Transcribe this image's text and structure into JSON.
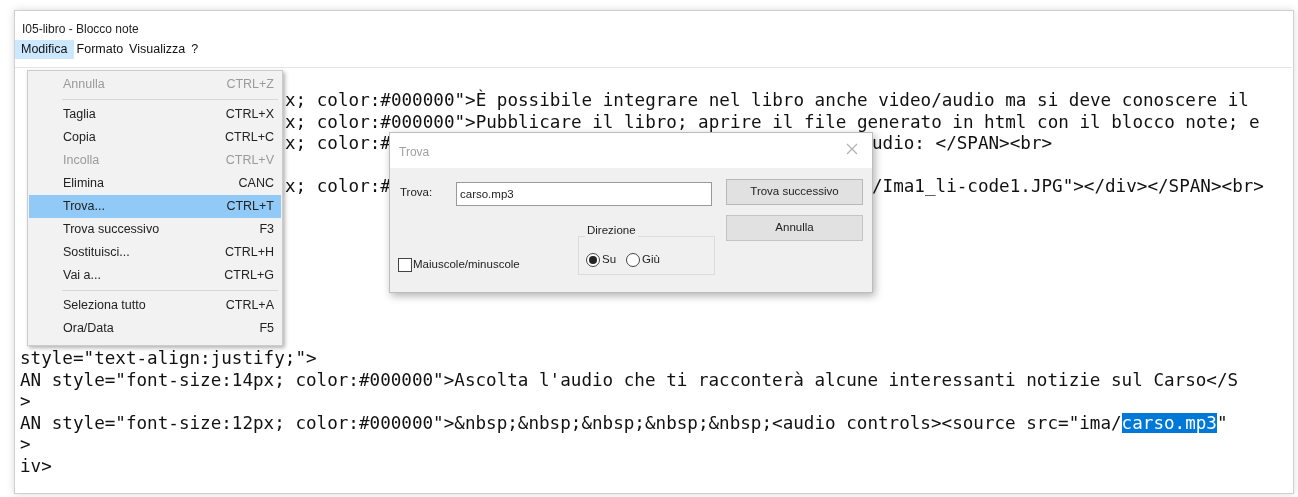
{
  "window": {
    "title": "I05-libro - Blocco note"
  },
  "menubar": [
    {
      "label": "Modifica",
      "selected": true
    },
    {
      "label": "Formato",
      "selected": false
    },
    {
      "label": "Visualizza",
      "selected": false
    },
    {
      "label": "?",
      "selected": false
    }
  ],
  "editor": {
    "lines": [
      {
        "kind": "partial",
        "text": "x; color:#000000\">È possibile integrare nel libro anche video/audio ma si deve conoscere il"
      },
      {
        "kind": "partial",
        "text": "x; color:#000000\">Pubblicare il libro; aprire il file generato in html con il blocco note; e"
      },
      {
        "kind": "split",
        "left": "x; color:#",
        "right": "udio: </SPAN><br>"
      },
      {
        "kind": "blank"
      },
      {
        "kind": "split",
        "left": "x; color:#",
        "right": "/Ima1_li-code1.JPG\"></div></SPAN><br>"
      },
      {
        "kind": "blank"
      },
      {
        "kind": "blank"
      },
      {
        "kind": "blank"
      },
      {
        "kind": "blank"
      },
      {
        "kind": "blank"
      },
      {
        "kind": "blank"
      },
      {
        "kind": "blank"
      },
      {
        "kind": "full",
        "text": "style=\"text-align:justify;\">"
      },
      {
        "kind": "full",
        "text": "AN style=\"font-size:14px; color:#000000\">Ascolta l'audio che ti racconterà alcune interessanti notizie sul Carso</S"
      },
      {
        "kind": "full",
        "text": ">"
      },
      {
        "kind": "selection",
        "before": "AN style=\"font-size:12px; color:#000000\">&nbsp;&nbsp;&nbsp;&nbsp;&nbsp;<audio controls><source src=\"ima/",
        "selected": "carso.mp3",
        "after": "\""
      },
      {
        "kind": "full",
        "text": ">"
      },
      {
        "kind": "full",
        "text": "iv>"
      }
    ]
  },
  "edit_menu": {
    "items": [
      {
        "label": "Annulla",
        "shortcut": "CTRL+Z",
        "disabled": true,
        "highlighted": false,
        "separator_after": true
      },
      {
        "label": "Taglia",
        "shortcut": "CTRL+X",
        "disabled": false,
        "highlighted": false,
        "separator_after": false
      },
      {
        "label": "Copia",
        "shortcut": "CTRL+C",
        "disabled": false,
        "highlighted": false,
        "separator_after": false
      },
      {
        "label": "Incolla",
        "shortcut": "CTRL+V",
        "disabled": true,
        "highlighted": false,
        "separator_after": false
      },
      {
        "label": "Elimina",
        "shortcut": "CANC",
        "disabled": false,
        "highlighted": false,
        "separator_after": false
      },
      {
        "label": "Trova...",
        "shortcut": "CTRL+T",
        "disabled": false,
        "highlighted": true,
        "separator_after": false
      },
      {
        "label": "Trova successivo",
        "shortcut": "F3",
        "disabled": false,
        "highlighted": false,
        "separator_after": false
      },
      {
        "label": "Sostituisci...",
        "shortcut": "CTRL+H",
        "disabled": false,
        "highlighted": false,
        "separator_after": false
      },
      {
        "label": "Vai a...",
        "shortcut": "CTRL+G",
        "disabled": false,
        "highlighted": false,
        "separator_after": true
      },
      {
        "label": "Seleziona tutto",
        "shortcut": "CTRL+A",
        "disabled": false,
        "highlighted": false,
        "separator_after": false
      },
      {
        "label": "Ora/Data",
        "shortcut": "F5",
        "disabled": false,
        "highlighted": false,
        "separator_after": false
      }
    ]
  },
  "find_dialog": {
    "title": "Trova",
    "find_label": "Trova:",
    "find_value": "carso.mp3",
    "buttons": [
      {
        "label": "Trova successivo",
        "default": true
      },
      {
        "label": "Annulla",
        "default": false
      }
    ],
    "direction": {
      "legend": "Direzione",
      "options": [
        {
          "label": "Su",
          "selected": true
        },
        {
          "label": "Giù",
          "selected": false
        }
      ]
    },
    "match_case": {
      "label": "Maiuscole/minuscole",
      "checked": false
    }
  }
}
